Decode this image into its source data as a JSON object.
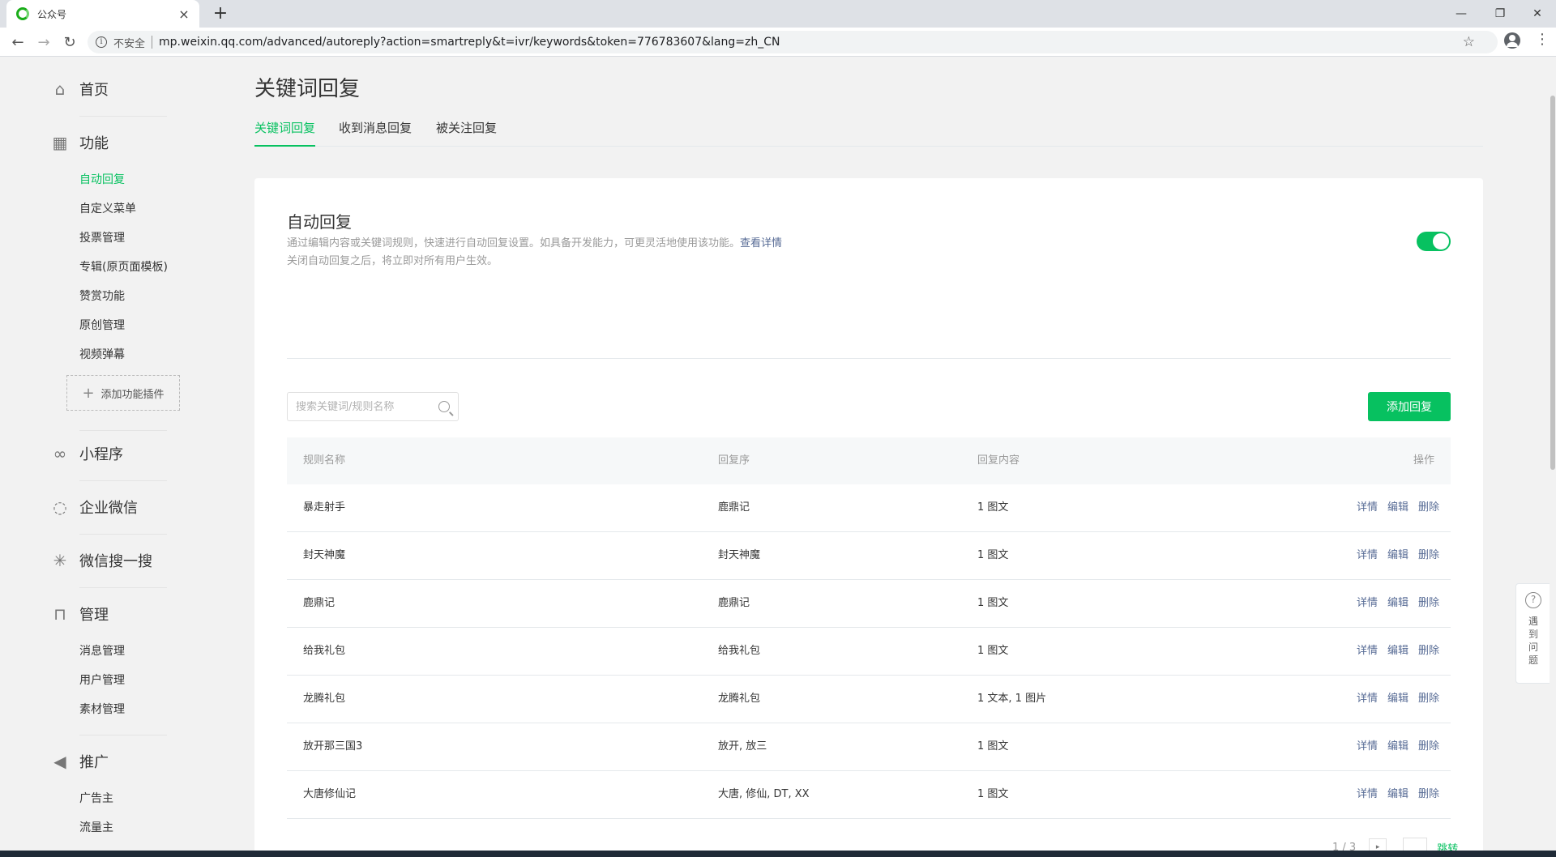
{
  "browser": {
    "tab_title": "公众号",
    "tab_close": "×",
    "new_tab": "+",
    "insecure_label": "不安全",
    "url": "mp.weixin.qq.com/advanced/autoreply?action=smartreply&t=ivr/keywords&token=776783607&lang=zh_CN",
    "icons": {
      "back": "arrow-left-icon",
      "forward": "arrow-right-icon",
      "reload": "reload-icon",
      "star": "star-icon",
      "profile": "profile-icon",
      "menu": "kebab-icon",
      "minimize": "minimize-icon",
      "maximize": "restore-icon",
      "close": "close-icon"
    }
  },
  "sidebar": {
    "home": "首页",
    "function": "功能",
    "function_items": [
      "自动回复",
      "自定义菜单",
      "投票管理",
      "专辑(原页面模板)",
      "赞赏功能",
      "原创管理",
      "视频弹幕"
    ],
    "add_plugin": "添加功能插件",
    "miniprogram": "小程序",
    "wework": "企业微信",
    "search": "微信搜一搜",
    "manage": "管理",
    "manage_items": [
      "消息管理",
      "用户管理",
      "素材管理"
    ],
    "promote": "推广",
    "promote_items": [
      "广告主",
      "流量主"
    ]
  },
  "main": {
    "page_title": "关键词回复",
    "tabs": [
      "关键词回复",
      "收到消息回复",
      "被关注回复"
    ],
    "card": {
      "title": "自动回复",
      "desc_line1": "通过编辑内容或关键词规则，快速进行自动回复设置。如具备开发能力，可更灵活地使用该功能。",
      "desc_link": "查看详情",
      "desc_line2": "关闭自动回复之后，将立即对所有用户生效。",
      "toggle_on": true,
      "accent": "#07c160"
    },
    "search_placeholder": "搜索关键词/规则名称",
    "add_button": "添加回复",
    "table": {
      "headers": [
        "规则名称",
        "回复序",
        "回复内容",
        "操作"
      ],
      "rows": [
        {
          "name": "暴走射手",
          "keywords": "鹿鼎记",
          "content": "1 图文"
        },
        {
          "name": "封天神魔",
          "keywords": "封天神魔",
          "content": "1 图文"
        },
        {
          "name": "鹿鼎记",
          "keywords": "鹿鼎记",
          "content": "1 图文"
        },
        {
          "name": "给我礼包",
          "keywords": "给我礼包",
          "content": "1 图文"
        },
        {
          "name": "龙腾礼包",
          "keywords": "龙腾礼包",
          "content": "1 文本, 1 图片"
        },
        {
          "name": "放开那三国3",
          "keywords": "放开, 放三",
          "content": "1 图文"
        },
        {
          "name": "大唐修仙记",
          "keywords": "大唐, 修仙, DT, XX",
          "content": "1 图文"
        }
      ],
      "ops": [
        "详情",
        "编辑",
        "删除"
      ]
    },
    "pager": {
      "text": "1 / 3",
      "jump": "跳转",
      "next": "▸"
    }
  },
  "help": {
    "text": "遇到问题",
    "q": "?"
  }
}
